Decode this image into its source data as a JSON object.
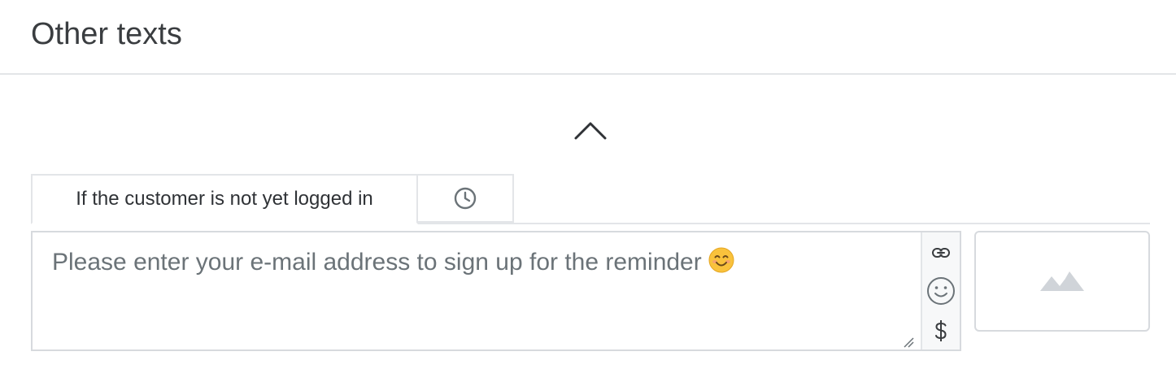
{
  "section": {
    "title": "Other texts"
  },
  "collapse": {
    "icon": "chevron-up-icon"
  },
  "tabs": [
    {
      "label": "If the customer is not yet logged in",
      "active": true
    },
    {
      "label": "",
      "icon": "clock-icon",
      "active": false
    }
  ],
  "editor": {
    "text": "Please enter your e-mail address to sign up for the reminder",
    "emoji": "smiling-face-emoji",
    "toolbar": {
      "items": [
        {
          "icon": "link-icon"
        },
        {
          "icon": "smiley-icon"
        },
        {
          "icon": "dollar-icon"
        }
      ]
    }
  },
  "image_placeholder": {
    "icon": "mountain-image-icon"
  },
  "colors": {
    "title": "#3a3d40",
    "border": "#d7dade",
    "divider": "#e3e5e8",
    "text_muted": "#6b7378",
    "icon_muted": "#d0d4d9"
  }
}
